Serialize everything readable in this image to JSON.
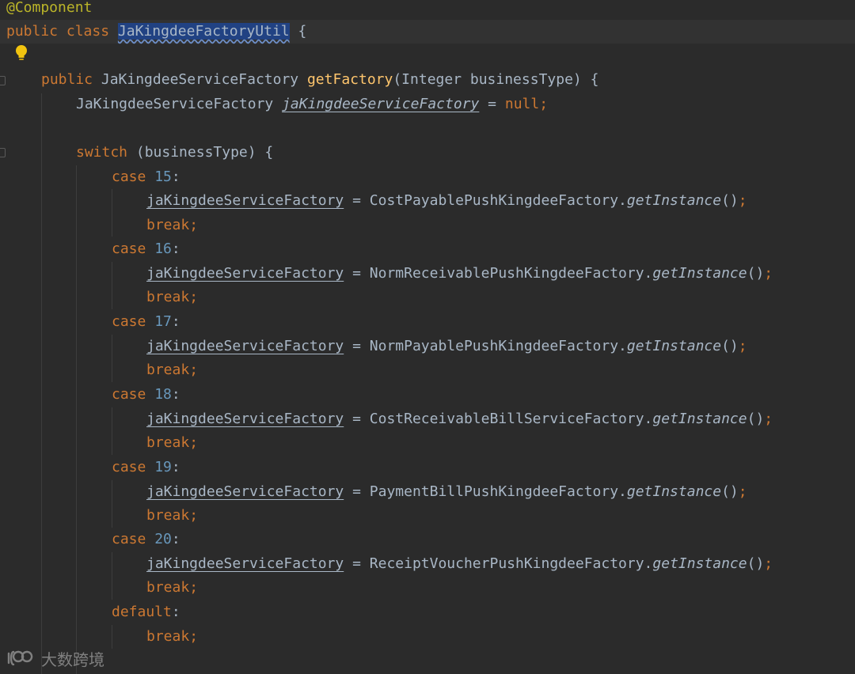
{
  "colors": {
    "background": "#2b2b2b",
    "keyword": "#cc7832",
    "number": "#6897bb",
    "annotation": "#bbb529",
    "method": "#ffc66d",
    "text": "#a9b7c6",
    "selection": "#214283"
  },
  "code": {
    "l0": {
      "annotation": "@Component"
    },
    "l1": {
      "kw1": "public",
      "kw2": "class",
      "class_name": "JaKingdeeFactoryUtil",
      "brace": " {"
    },
    "l3": {
      "kw": "public",
      "ret": "JaKingdeeServiceFactory",
      "method": "getFactory",
      "params": "(Integer businessType) {"
    },
    "l4": {
      "type": "JaKingdeeServiceFactory",
      "field": "jaKingdeeServiceFactory",
      "eq": " = ",
      "null": "null",
      "semi": ";"
    },
    "l6": {
      "kw": "switch",
      "rest": " (businessType) {"
    },
    "cases": [
      {
        "case_kw": "case",
        "num": "15",
        "colon": ":",
        "field": "jaKingdeeServiceFactory",
        "eq": " = ",
        "cls": "CostPayablePushKingdeeFactory.",
        "call": "getInstance",
        "parens": "()",
        "semi": ";",
        "brk": "break",
        "brk_semi": ";"
      },
      {
        "case_kw": "case",
        "num": "16",
        "colon": ":",
        "field": "jaKingdeeServiceFactory",
        "eq": " = ",
        "cls": "NormReceivablePushKingdeeFactory.",
        "call": "getInstance",
        "parens": "()",
        "semi": ";",
        "brk": "break",
        "brk_semi": ";"
      },
      {
        "case_kw": "case",
        "num": "17",
        "colon": ":",
        "field": "jaKingdeeServiceFactory",
        "eq": " = ",
        "cls": "NormPayablePushKingdeeFactory.",
        "call": "getInstance",
        "parens": "()",
        "semi": ";",
        "brk": "break",
        "brk_semi": ";"
      },
      {
        "case_kw": "case",
        "num": "18",
        "colon": ":",
        "field": "jaKingdeeServiceFactory",
        "eq": " = ",
        "cls": "CostReceivableBillServiceFactory.",
        "call": "getInstance",
        "parens": "()",
        "semi": ";",
        "brk": "break",
        "brk_semi": ";"
      },
      {
        "case_kw": "case",
        "num": "19",
        "colon": ":",
        "field": "jaKingdeeServiceFactory",
        "eq": " = ",
        "cls": "PaymentBillPushKingdeeFactory.",
        "call": "getInstance",
        "parens": "()",
        "semi": ";",
        "brk": "break",
        "brk_semi": ";"
      },
      {
        "case_kw": "case",
        "num": "20",
        "colon": ":",
        "field": "jaKingdeeServiceFactory",
        "eq": " = ",
        "cls": "ReceiptVoucherPushKingdeeFactory.",
        "call": "getInstance",
        "parens": "()",
        "semi": ";",
        "brk": "break",
        "brk_semi": ";"
      }
    ],
    "default": {
      "kw": "default",
      "colon": ":",
      "brk": "break",
      "brk_semi": ";"
    }
  },
  "icons": {
    "intention": "lightbulb-icon",
    "watermark_logo": "logo-icon"
  },
  "watermark": {
    "text": "大数跨境"
  }
}
